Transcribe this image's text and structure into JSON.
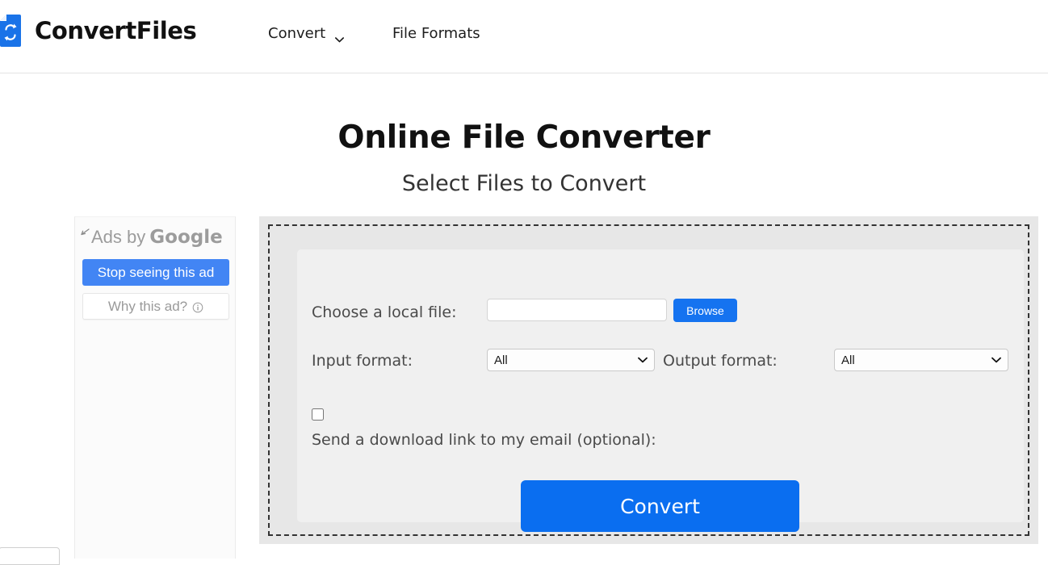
{
  "header": {
    "brand_name": "ConvertFiles",
    "logo_icon": "document-refresh-icon",
    "nav": [
      {
        "label": "Convert",
        "icon": "chevron-down-icon"
      },
      {
        "label": "File Formats"
      }
    ]
  },
  "hero": {
    "title": "Online File Converter",
    "subtitle": "Select Files to Convert"
  },
  "ads": {
    "back_icon": "back-arrow-icon",
    "attribution_prefix": "Ads by",
    "attribution_brand": "Google",
    "stop_button": "Stop seeing this ad",
    "why_button": "Why this ad?",
    "why_icon": "info-circle-icon"
  },
  "converter": {
    "local_file_label": "Choose a local file:",
    "file_value": "",
    "file_placeholder": "",
    "browse_button": "Browse",
    "input_format_label": "Input format:",
    "input_format_value": "All",
    "output_format_label": "Output format:",
    "output_format_value": "All",
    "format_options": [
      "All"
    ],
    "email_checkbox_checked": false,
    "email_label": "Send a download link to my email (optional):",
    "convert_button": "Convert"
  },
  "colors": {
    "primary_blue": "#0a6ef0",
    "browse_blue": "#1573f0",
    "google_ad_blue": "#4285f4",
    "panel_gray": "#f0f0f0",
    "container_gray": "#e7e7e7",
    "dashed_border": "#333333"
  }
}
